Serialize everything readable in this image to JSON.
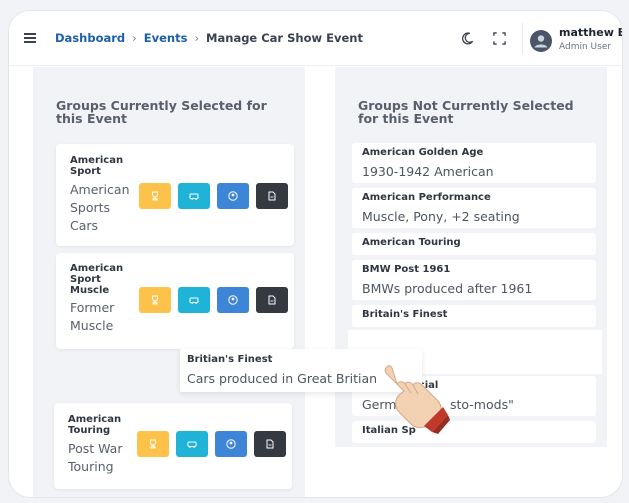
{
  "header": {
    "breadcrumb": [
      {
        "label": "Dashboard"
      },
      {
        "label": "Events"
      },
      {
        "label": "Manage Car Show Event"
      }
    ],
    "user": {
      "name": "matthew Eb",
      "role": "Admin User"
    }
  },
  "left_panel": {
    "title": "Groups Currently Selected for this Event",
    "cards": [
      {
        "name": "American Sport",
        "description": "American Sports Cars"
      },
      {
        "name": "American Sport Muscle",
        "description": "Former Muscle"
      },
      {
        "name": "American Touring",
        "description": "Post War Touring"
      }
    ]
  },
  "right_panel": {
    "title": "Groups Not Currently Selected for this Event",
    "cards": [
      {
        "name": "American Golden Age",
        "description": "1930-1942 American"
      },
      {
        "name": "American Performance",
        "description": "Muscle, Pony, +2 seating"
      },
      {
        "name": "American Touring",
        "description": ""
      },
      {
        "name": "BMW Post 1961",
        "description": "BMWs produced after 1961"
      },
      {
        "name": "Britain's Finest",
        "description": ""
      },
      {
        "name": "ecial",
        "description": "Germ",
        "description_tail": "sto-mods\""
      },
      {
        "name": "Italian Sp",
        "description": ""
      }
    ]
  },
  "dragged_card": {
    "name": "Britian's Finest",
    "description": "Cars produced in Great Britian"
  },
  "icons": {
    "menu": "hamburger-icon",
    "theme": "moon-icon",
    "fullscreen": "fullscreen-icon",
    "actions": [
      "trophy-icon",
      "car-icon",
      "user-circle-icon",
      "document-icon"
    ],
    "cursor": "hand-pointer-icon"
  },
  "colors": {
    "link": "#1d5fa8",
    "yellow": "#fcc24a",
    "cyan": "#1fb3d8",
    "blue": "#3d85d6",
    "dark": "#343a40"
  }
}
